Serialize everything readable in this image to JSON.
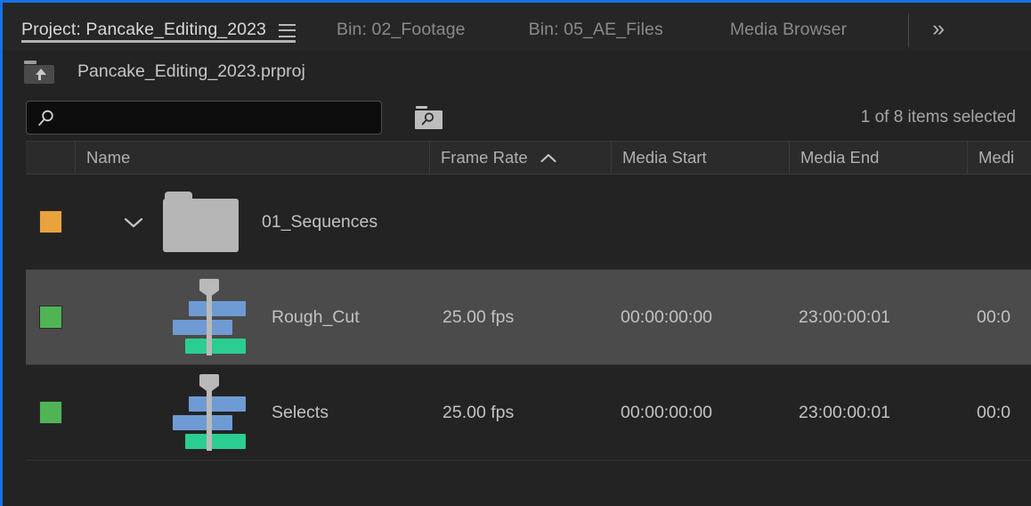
{
  "colors": {
    "focus_border": "#1473e6",
    "panel_bg": "#232323",
    "tabbar_bg": "#262626",
    "row_selected_bg": "#4b4b4b",
    "label_orange": "#e8a33d",
    "label_green": "#50b455",
    "sequence_video_clip": "#6e9bd4",
    "sequence_audio_clip": "#2bce90",
    "folder_gray": "#b6b6b6"
  },
  "tabs": [
    {
      "label": "Project: Pancake_Editing_2023",
      "active": true,
      "has_menu": true
    },
    {
      "label": "Bin: 02_Footage",
      "active": false,
      "has_menu": false
    },
    {
      "label": "Bin: 05_AE_Files",
      "active": false,
      "has_menu": false
    },
    {
      "label": "Media Browser",
      "active": false,
      "has_menu": false
    }
  ],
  "tabbar": {
    "panel_menu_icon": "hamburger-icon",
    "overflow_label": "»",
    "overflow_icon": "double-chevron-right-icon"
  },
  "path_row": {
    "parent_folder_icon": "parent-folder-up-icon",
    "label": "Pancake_Editing_2023.prproj"
  },
  "search": {
    "value": "",
    "placeholder": "",
    "icon": "magnifier-icon",
    "find_button_icon": "find-in-bin-icon"
  },
  "status": {
    "selection": "1 of 8 items selected"
  },
  "table": {
    "columns": [
      {
        "key": "spacer",
        "label": "",
        "sorted": false
      },
      {
        "key": "name",
        "label": "Name",
        "sorted": false
      },
      {
        "key": "fps",
        "label": "Frame Rate",
        "sorted": true,
        "sort_dir": "asc",
        "sort_icon": "chevron-up-icon"
      },
      {
        "key": "mstart",
        "label": "Media Start",
        "sorted": false
      },
      {
        "key": "mend",
        "label": "Media End",
        "sorted": false
      },
      {
        "key": "mdur",
        "label": "Medi",
        "sorted": false
      }
    ],
    "rows": [
      {
        "type": "folder",
        "label_color": "#e8a33d",
        "expanded": true,
        "disclosure_icon": "chevron-down-icon",
        "item_icon": "folder-icon",
        "name": "01_Sequences",
        "fps": "",
        "media_start": "",
        "media_end": "",
        "media_duration": "",
        "selected": false
      },
      {
        "type": "sequence",
        "label_color": "#50b455",
        "item_icon": "sequence-icon",
        "name": "Rough_Cut",
        "fps": "25.00 fps",
        "media_start": "00:00:00:00",
        "media_end": "23:00:00:01",
        "media_duration": "00:0",
        "selected": true
      },
      {
        "type": "sequence",
        "label_color": "#50b455",
        "item_icon": "sequence-icon",
        "name": "Selects",
        "fps": "25.00 fps",
        "media_start": "00:00:00:00",
        "media_end": "23:00:00:01",
        "media_duration": "00:0",
        "selected": false
      }
    ]
  }
}
